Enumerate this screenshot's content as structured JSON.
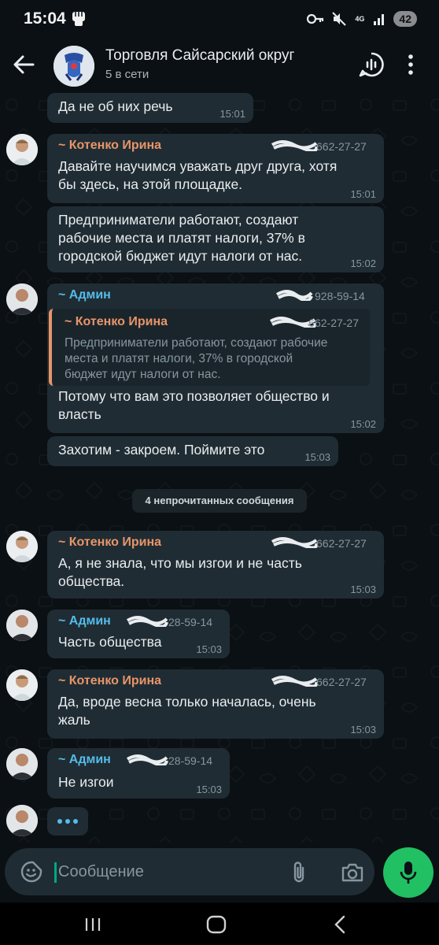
{
  "status_bar": {
    "time": "15:04",
    "network": "4G",
    "battery": "42"
  },
  "header": {
    "title": "Торговля Сайсарский округ",
    "subtitle": "5 в сети"
  },
  "divider": "4 непрочитанных сообщения",
  "messages": [
    {
      "sender": "",
      "text": "Да не об них речь",
      "time": "15:01"
    },
    {
      "sender": "~ Котенко Ирина",
      "phone": "662-27-27",
      "text": "Давайте научимся уважать друг друга, хотя\nбы здесь, на этой площадке.",
      "time": "15:01"
    },
    {
      "sender": "",
      "text": "Предприниматели работают, создают\nрабочие места и платят налоги, 37% в\nгородской бюджет идут налоги от нас.",
      "time": "15:02"
    },
    {
      "sender": "~ Админ",
      "phone": "928-59-14",
      "quote": {
        "sender": "~ Котенко Ирина",
        "phone": "662-27-27",
        "text": "Предприниматели работают, создают рабочие\nместа и платят налоги, 37% в городской\nбюджет идут налоги от нас."
      },
      "text": "Потому что вам это позволяет общество и\nвласть",
      "time": "15:02"
    },
    {
      "sender": "",
      "text": "Захотим - закроем. Поймите это",
      "time": "15:03"
    },
    {
      "sender": "~ Котенко Ирина",
      "phone": "662-27-27",
      "text": "А, я не знала, что мы изгои и не часть\nобщества.",
      "time": "15:03"
    },
    {
      "sender": "~ Админ",
      "phone": "28-59-14",
      "text": "Часть общества",
      "time": "15:03"
    },
    {
      "sender": "~ Котенко Ирина",
      "phone": "662-27-27",
      "text": "Да, вроде весна только началась, очень\nжаль",
      "time": "15:03"
    },
    {
      "sender": "~ Админ",
      "phone": "28-59-14",
      "text": "Не изгои",
      "time": "15:03"
    }
  ],
  "composer": {
    "placeholder": "Сообщение"
  },
  "colors": {
    "accent": "#21c063",
    "bubble": "#202c33",
    "sender_irina": "#e8956a",
    "sender_admin": "#53bdeb"
  },
  "icons": [
    "back-arrow-icon",
    "voice-chat-icon",
    "more-vert-icon",
    "sticker-icon",
    "paperclip-icon",
    "camera-icon",
    "mic-icon",
    "key-icon",
    "mute-icon",
    "signal-icon"
  ]
}
